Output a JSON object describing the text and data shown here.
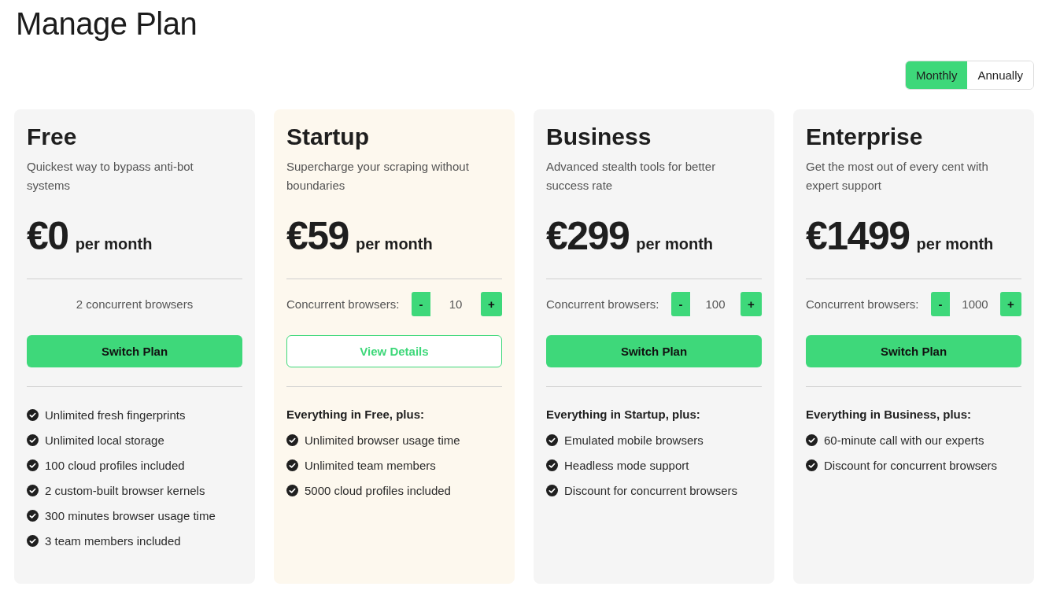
{
  "page_title": "Manage Plan",
  "billing_toggle": [
    {
      "label": "Monthly",
      "selected": true
    },
    {
      "label": "Annually",
      "selected": false
    }
  ],
  "plans": [
    {
      "name": "Free",
      "current": false,
      "description": "Quickest way to bypass anti-bot systems",
      "price": "€0",
      "period": "per month",
      "browsers": {
        "kind": "text",
        "text": "2 concurrent browsers"
      },
      "action": "Switch Plan",
      "features": [
        "Unlimited fresh fingerprints",
        "Unlimited local storage",
        "100 cloud profiles included",
        "2 custom-built browser kernels",
        "300 minutes browser usage time",
        "3 team members included"
      ]
    },
    {
      "name": "Startup",
      "current": true,
      "description": "Supercharge your scraping without boundaries",
      "price": "€59",
      "period": "per month",
      "browsers": {
        "kind": "stepper",
        "label": "Concurrent browsers:",
        "decrement": "-",
        "value": "10",
        "increment": "+"
      },
      "action": "View Details",
      "features_heading": "Everything in Free, plus:",
      "features": [
        "Unlimited browser usage time",
        "Unlimited team members",
        "5000 cloud profiles included"
      ]
    },
    {
      "name": "Business",
      "current": false,
      "description": "Advanced stealth tools for better success rate",
      "price": "€299",
      "period": "per month",
      "browsers": {
        "kind": "stepper",
        "label": "Concurrent browsers:",
        "decrement": "-",
        "value": "100",
        "increment": "+"
      },
      "action": "Switch Plan",
      "features_heading": "Everything in Startup, plus:",
      "features": [
        "Emulated mobile browsers",
        "Headless mode support",
        "Discount for concurrent browsers"
      ]
    },
    {
      "name": "Enterprise",
      "current": false,
      "description": "Get the most out of every cent with expert support",
      "price": "€1499",
      "period": "per month",
      "browsers": {
        "kind": "stepper",
        "label": "Concurrent browsers:",
        "decrement": "-",
        "value": "1000",
        "increment": "+"
      },
      "action": "Switch Plan",
      "features_heading": "Everything in Business, plus:",
      "features": [
        "60-minute call with our experts",
        "Discount for concurrent browsers"
      ]
    }
  ]
}
